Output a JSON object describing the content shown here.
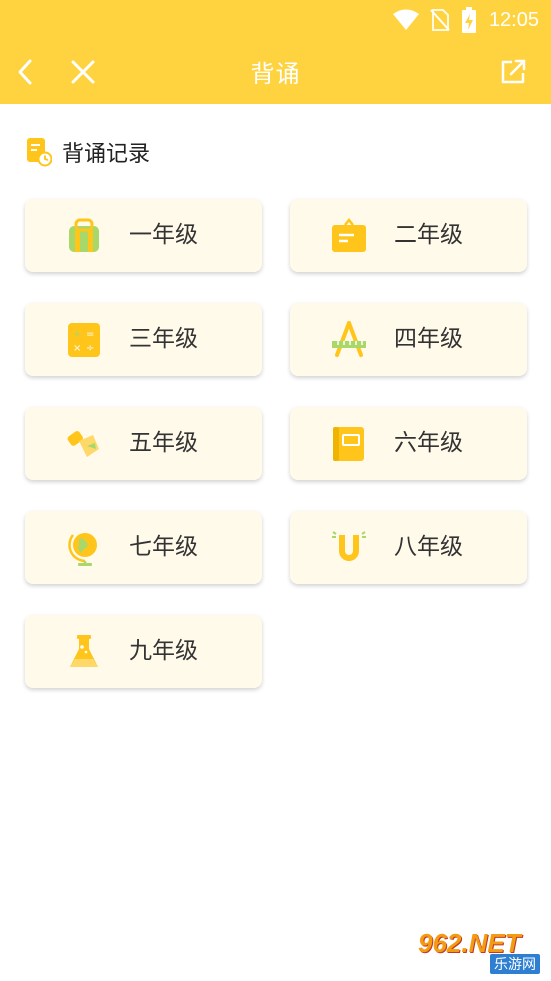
{
  "status": {
    "time": "12:05"
  },
  "toolbar": {
    "title": "背诵"
  },
  "section": {
    "title": "背诵记录"
  },
  "grades": [
    {
      "label": "一年级",
      "icon": "backpack-icon"
    },
    {
      "label": "二年级",
      "icon": "briefcase-icon"
    },
    {
      "label": "三年级",
      "icon": "calculator-icon"
    },
    {
      "label": "四年级",
      "icon": "compass-ruler-icon"
    },
    {
      "label": "五年级",
      "icon": "pencil-eraser-icon"
    },
    {
      "label": "六年级",
      "icon": "notebook-icon"
    },
    {
      "label": "七年级",
      "icon": "globe-icon"
    },
    {
      "label": "八年级",
      "icon": "magnet-icon"
    },
    {
      "label": "九年级",
      "icon": "flask-icon"
    }
  ],
  "watermark": {
    "big": "962.NET",
    "small": "乐游网"
  },
  "colors": {
    "accent": "#ffd33f",
    "card_bg": "#fffaea",
    "icon_yellow": "#ffc51a",
    "icon_green": "#a8d86a"
  }
}
